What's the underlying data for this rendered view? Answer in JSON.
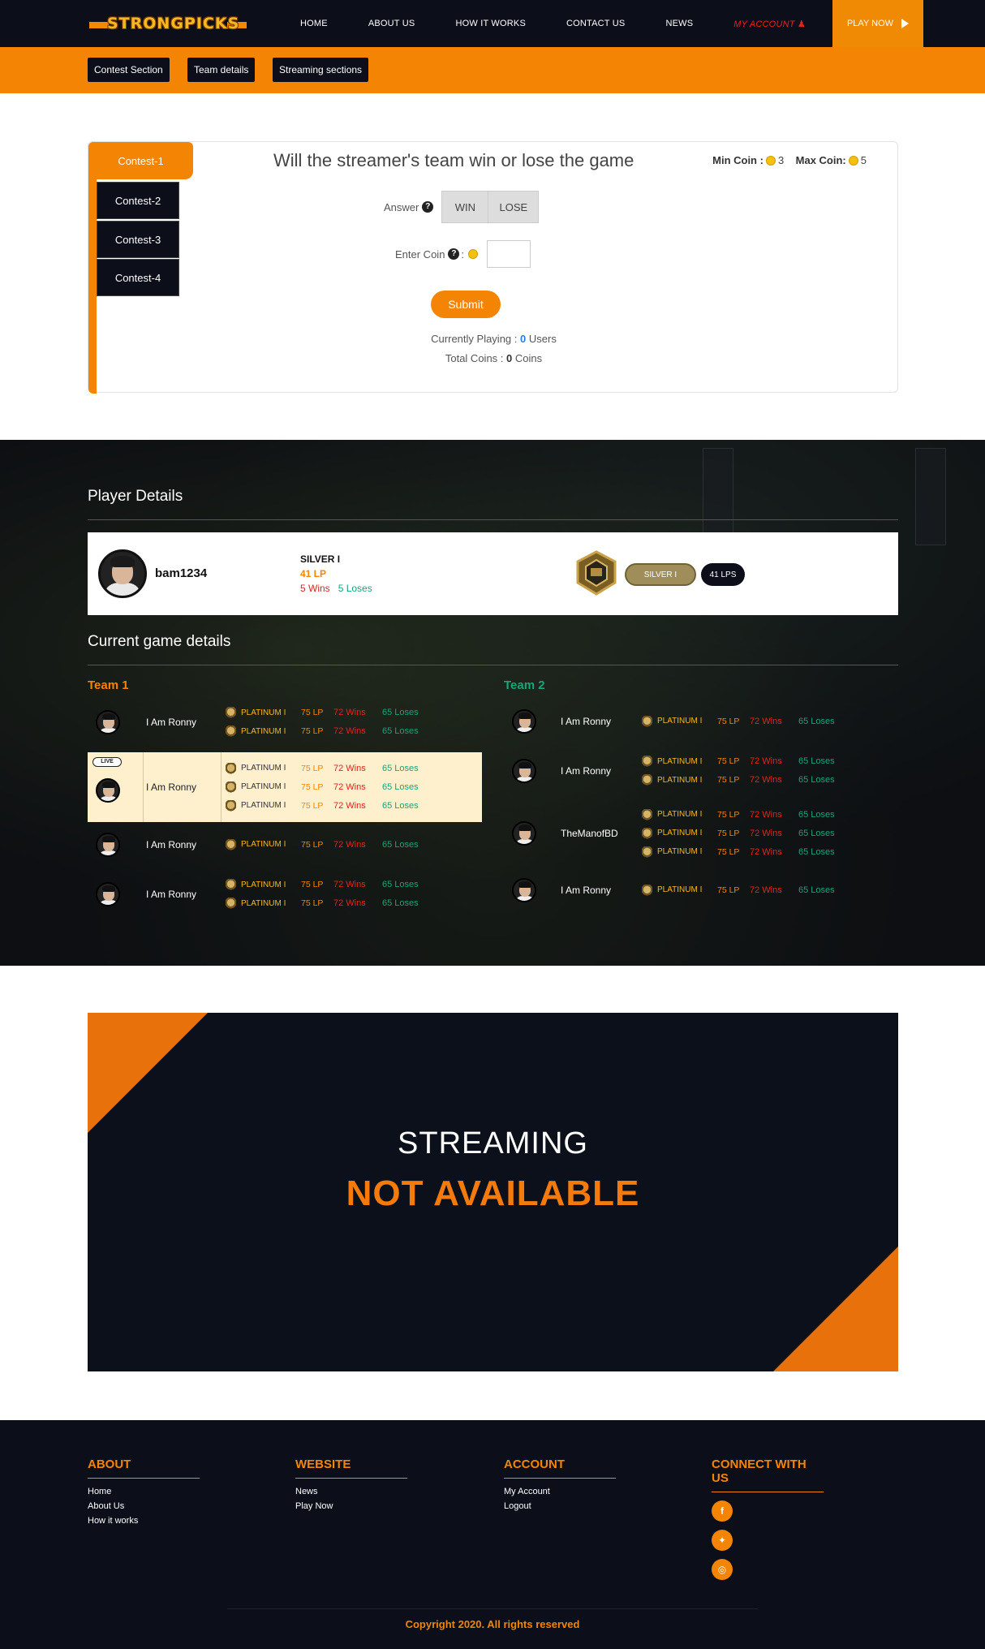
{
  "nav": {
    "logo": "STRONGPICKS",
    "items": [
      "HOME",
      "ABOUT US",
      "HOW IT WORKS",
      "CONTACT US",
      "NEWS"
    ],
    "account": "MY ACCOUNT",
    "play": "PLAY NOW"
  },
  "subnav": [
    "Contest Section",
    "Team details",
    "Streaming sections"
  ],
  "contest": {
    "tabs": [
      "Contest-1",
      "Contest-2",
      "Contest-3",
      "Contest-4"
    ],
    "question": "Will the streamer's team win or lose the game",
    "min_label": "Min Coin :",
    "min_value": "3",
    "max_label": "Max Coin:",
    "max_value": "5",
    "answer_label": "Answer",
    "win": "WIN",
    "lose": "LOSE",
    "coin_label": "Enter Coin",
    "coin_sep": ":",
    "help": "?",
    "coin_input": "",
    "submit": "Submit",
    "playing_label": "Currently Playing :",
    "playing_value": "0",
    "playing_unit": "Users",
    "total_label": "Total Coins :",
    "total_value": "0",
    "total_unit": "Coins"
  },
  "player": {
    "heading": "Player Details",
    "name": "bam1234",
    "rank": "SILVER I",
    "lp": "41 LP",
    "wins": "5 Wins",
    "loses": "5 Loses",
    "badge_rank": "SILVER I",
    "badge_lp": "41 LPS"
  },
  "game": {
    "heading": "Current game details",
    "team1_label": "Team 1",
    "team2_label": "Team 2",
    "live": "LIVE",
    "team1": [
      {
        "name": "I Am Ronny",
        "stats": [
          [
            "PLATINUM I",
            "75 LP",
            "72 Wins",
            "65 Loses"
          ],
          [
            "PLATINUM I",
            "75 LP",
            "72 Wins",
            "65 Loses"
          ]
        ]
      },
      {
        "name": "I Am Ronny",
        "live": true,
        "stats": [
          [
            "PLATINUM I",
            "75 LP",
            "72 Wins",
            "65 Loses"
          ],
          [
            "PLATINUM I",
            "75 LP",
            "72 Wins",
            "65 Loses"
          ],
          [
            "PLATINUM I",
            "75 LP",
            "72 Wins",
            "65 Loses"
          ]
        ]
      },
      {
        "name": "I Am Ronny",
        "stats": [
          [
            "PLATINUM I",
            "75 LP",
            "72 Wins",
            "65 Loses"
          ]
        ]
      },
      {
        "name": "I Am Ronny",
        "stats": [
          [
            "PLATINUM I",
            "75 LP",
            "72 Wins",
            "65 Loses"
          ],
          [
            "PLATINUM I",
            "75 LP",
            "72 Wins",
            "65 Loses"
          ]
        ]
      }
    ],
    "team2": [
      {
        "name": "I Am Ronny",
        "stats": [
          [
            "PLATINUM I",
            "75 LP",
            "72 Wins",
            "65 Loses"
          ]
        ]
      },
      {
        "name": "I Am Ronny",
        "stats": [
          [
            "PLATINUM I",
            "75 LP",
            "72 Wins",
            "65 Loses"
          ],
          [
            "PLATINUM I",
            "75 LP",
            "72 Wins",
            "65 Loses"
          ]
        ]
      },
      {
        "name": "TheManofBD",
        "stats": [
          [
            "PLATINUM I",
            "75 LP",
            "72 Wins",
            "65 Loses"
          ],
          [
            "PLATINUM I",
            "75 LP",
            "72 Wins",
            "65 Loses"
          ],
          [
            "PLATINUM I",
            "75 LP",
            "72 Wins",
            "65 Loses"
          ]
        ]
      },
      {
        "name": "I Am Ronny",
        "stats": [
          [
            "PLATINUM I",
            "75 LP",
            "72 Wins",
            "65 Loses"
          ]
        ]
      }
    ]
  },
  "stream": {
    "line1": "STREAMING",
    "line2": "NOT AVAILABLE"
  },
  "footer": {
    "about": {
      "title": "ABOUT",
      "links": [
        "Home",
        "About Us",
        "How it works"
      ]
    },
    "website": {
      "title": "WEBSITE",
      "links": [
        "News",
        "Play Now"
      ]
    },
    "account": {
      "title": "ACCOUNT",
      "links": [
        "My Account",
        "Logout"
      ]
    },
    "connect": {
      "title": "CONNECT WITH US",
      "icons": [
        "facebook-icon",
        "twitter-icon",
        "instagram-icon"
      ]
    },
    "copyright": "Copyright 2020. All rights reserved"
  },
  "colors": {
    "accent": "#f48504",
    "dark": "#0c0f1a",
    "win": "#e3221f",
    "lose": "#1aa37a",
    "highlight": "#feefcd"
  }
}
